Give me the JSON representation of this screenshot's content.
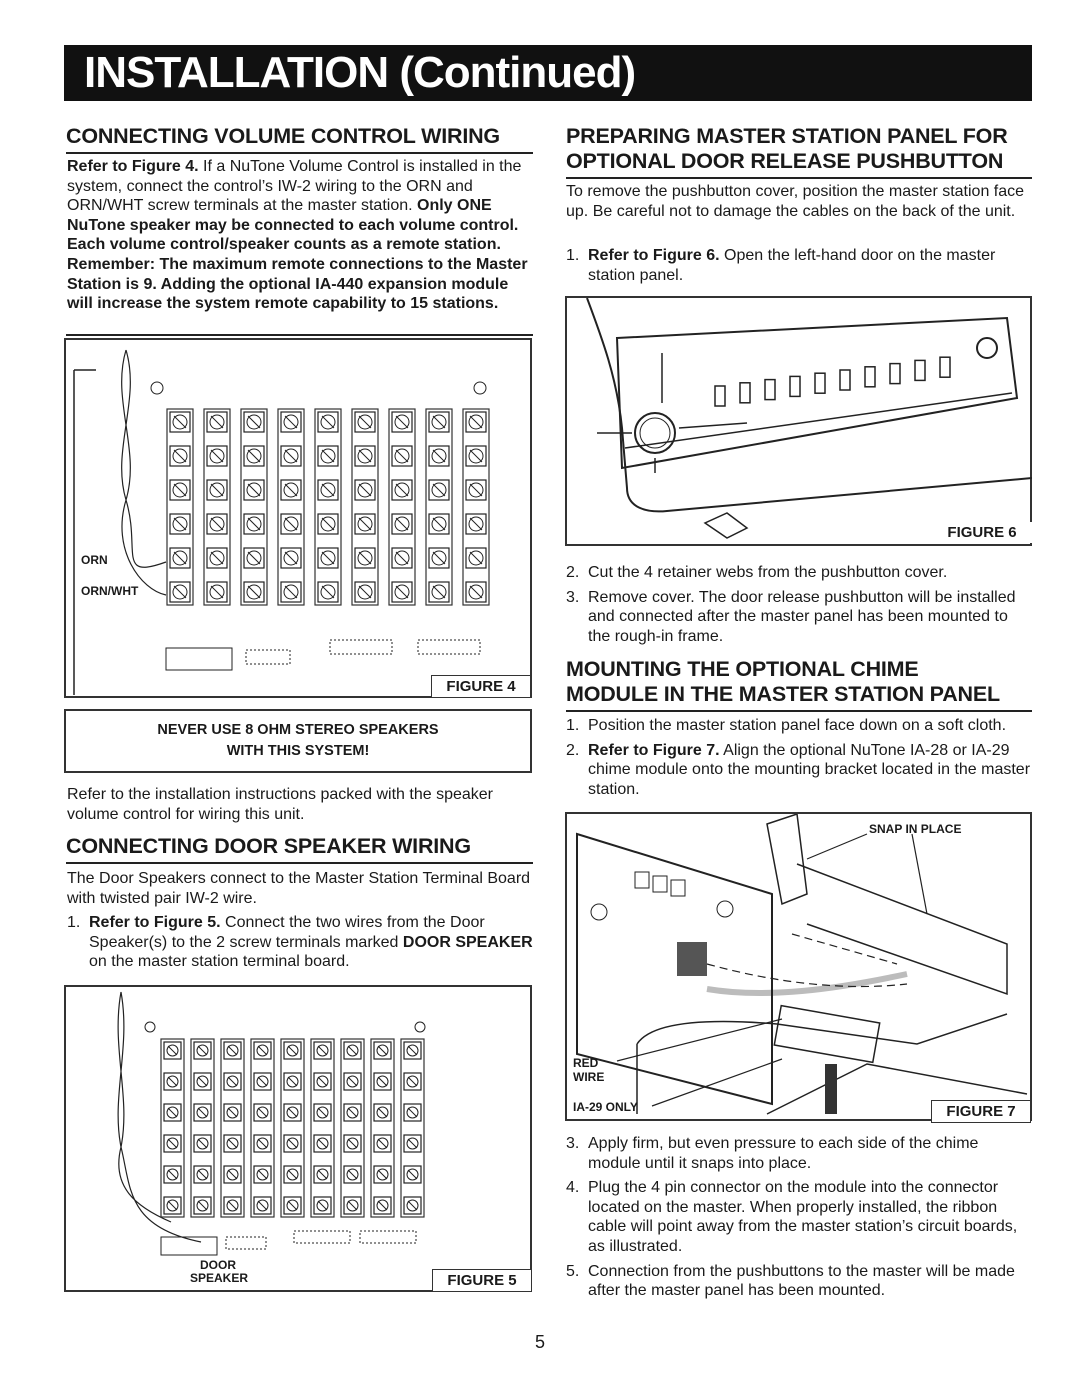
{
  "title": "INSTALLATION (Continued)",
  "left": {
    "volume": {
      "heading": "CONNECTING VOLUME CONTROL WIRING",
      "p1_bold": "Refer to Figure 4.",
      "p1_text": " If a NuTone Volume Control is installed in the system, connect the control’s IW-2 wiring to the ORN and ORN/WHT screw terminals at the master station. ",
      "p1_bold2": "Only ONE NuTone speaker may be connected to each volume control. Each volume control/speaker counts as a remote station. Remember: The maximum remote connections to the Master Station is 9. Adding the optional IA-440 expansion module will increase the system remote capability to 15 stations."
    },
    "figure4": {
      "label": "FIGURE 4",
      "orn": "ORN",
      "orn_wht": "ORN/WHT"
    },
    "warning": {
      "line1": "NEVER USE 8 OHM STEREO SPEAKERS",
      "line2": "WITH THIS SYSTEM!"
    },
    "refer_text": "Refer to the installation instructions packed with the speaker volume control for wiring this unit.",
    "door": {
      "heading": "CONNECTING DOOR SPEAKER WIRING",
      "p1": "The Door Speakers connect to the Master Station Terminal Board with twisted pair IW-2 wire.",
      "step1": {
        "num": "1.",
        "bold": "Refer to Figure 5.",
        "text": " Connect the two wires from the Door Speaker(s) to the 2 screw terminals marked ",
        "bold2": "DOOR SPEAKER",
        "text2": " on the master station terminal board."
      }
    },
    "figure5": {
      "label": "FIGURE 5",
      "door": "DOOR",
      "speaker": "SPEAKER"
    }
  },
  "right": {
    "prep": {
      "heading_line1": "PREPARING MASTER STATION PANEL FOR",
      "heading_line2": "OPTIONAL DOOR RELEASE PUSHBUTTON",
      "p1": "To remove the pushbutton cover, position the master station face up. Be careful not to damage the cables on the back of the unit.",
      "step1": {
        "num": "1.",
        "bold": "Refer to Figure 6.",
        "text": " Open the left-hand door on the master station panel."
      },
      "step2": {
        "num": "2.",
        "text": "Cut the 4 retainer webs from the pushbutton cover."
      },
      "step3": {
        "num": "3.",
        "text": "Remove cover. The door release pushbutton will be installed and connected after the master panel has been mounted to the rough-in frame."
      }
    },
    "figure6": {
      "label": "FIGURE 6"
    },
    "chime": {
      "heading_line1": "MOUNTING THE OPTIONAL CHIME",
      "heading_line2": "MODULE IN THE MASTER STATION PANEL",
      "step1": {
        "num": "1.",
        "text": "Position the master station panel face down on a soft cloth."
      },
      "step2": {
        "num": "2.",
        "bold": "Refer to Figure 7.",
        "text": " Align the optional NuTone IA-28 or IA-29 chime module onto the mounting bracket located in the master station."
      },
      "step3": {
        "num": "3.",
        "text": " Apply firm, but even pressure to each side of the chime module until it snaps into place."
      },
      "step4": {
        "num": "4.",
        "text": "Plug the 4 pin connector on the module into the connector located on the master. When properly installed, the ribbon cable will point away from the master station’s circuit boards, as illustrated."
      },
      "step5": {
        "num": "5.",
        "text": "Connection from the pushbuttons to the master will be made after the master panel has been mounted."
      }
    },
    "figure7": {
      "label": "FIGURE 7",
      "snap": "SNAP IN PLACE",
      "red": "RED",
      "wire": "WIRE",
      "ia29": "IA-29 ONLY"
    }
  },
  "page_number": "5"
}
